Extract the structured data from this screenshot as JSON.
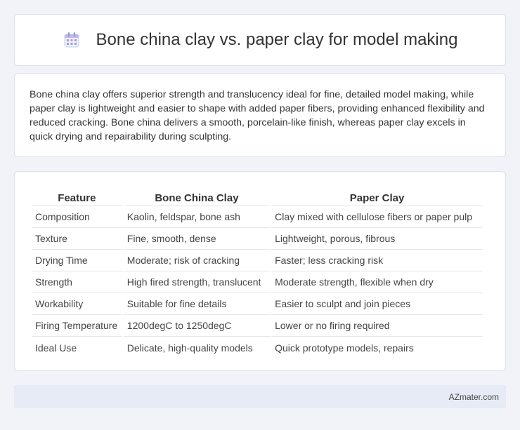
{
  "header": {
    "icon": "calendar-icon",
    "title": "Bone china clay vs. paper clay for model making"
  },
  "summary": {
    "text": "Bone china clay offers superior strength and translucency ideal for fine, detailed model making, while paper clay is lightweight and easier to shape with added paper fibers, providing enhanced flexibility and reduced cracking. Bone china delivers a smooth, porcelain-like finish, whereas paper clay excels in quick drying and repairability during sculpting."
  },
  "table": {
    "headers": [
      "Feature",
      "Bone China Clay",
      "Paper Clay"
    ],
    "rows": [
      [
        "Composition",
        "Kaolin, feldspar, bone ash",
        "Clay mixed with cellulose fibers or paper pulp"
      ],
      [
        "Texture",
        "Fine, smooth, dense",
        "Lightweight, porous, fibrous"
      ],
      [
        "Drying Time",
        "Moderate; risk of cracking",
        "Faster; less cracking risk"
      ],
      [
        "Strength",
        "High fired strength, translucent",
        "Moderate strength, flexible when dry"
      ],
      [
        "Workability",
        "Suitable for fine details",
        "Easier to sculpt and join pieces"
      ],
      [
        "Firing Temperature",
        "1200degC to 1250degC",
        "Lower or no firing required"
      ],
      [
        "Ideal Use",
        "Delicate, high-quality models",
        "Quick prototype models, repairs"
      ]
    ]
  },
  "footer": {
    "text": "AZmater.com"
  }
}
